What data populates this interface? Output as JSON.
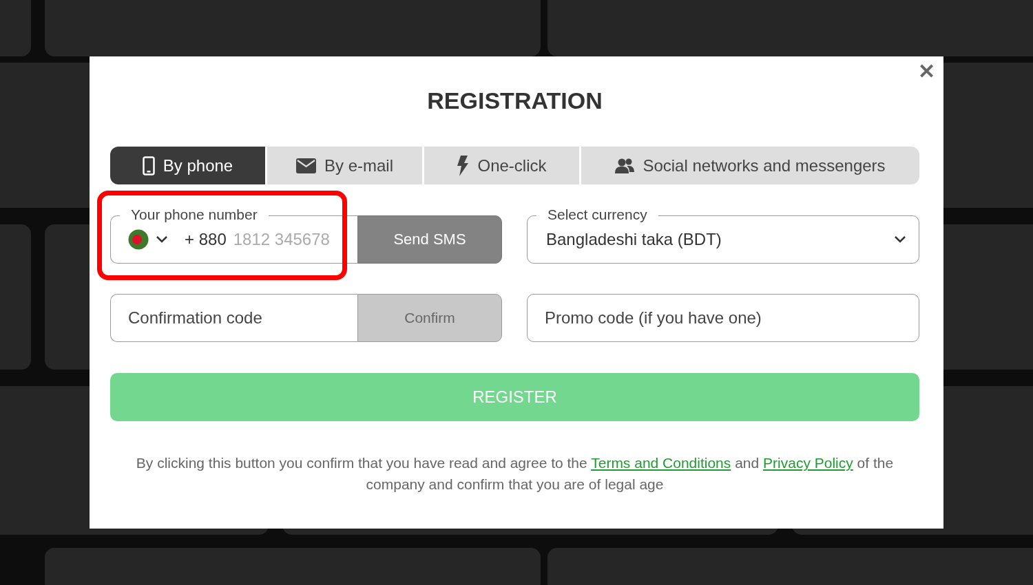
{
  "dialog": {
    "title": "REGISTRATION",
    "close": "✕"
  },
  "tabs": [
    {
      "label": "By phone",
      "kind": "phone",
      "selected": true
    },
    {
      "label": "By e-mail",
      "kind": "mail",
      "selected": false
    },
    {
      "label": "One-click",
      "kind": "bolt",
      "selected": false
    },
    {
      "label": "Social networks and messengers",
      "kind": "people",
      "selected": false
    }
  ],
  "phone": {
    "label": "Your phone number",
    "code": "+ 880",
    "placeholder": "1812 345678",
    "highlighted": true,
    "button": "Send SMS"
  },
  "currency": {
    "label": "Select currency",
    "value": "Bangladeshi taka (BDT)"
  },
  "confirmation": {
    "placeholder": "Confirmation code",
    "button": "Confirm"
  },
  "promo": {
    "placeholder": "Promo code (if you have one)"
  },
  "register_button": "REGISTER",
  "legal": {
    "before": "By clicking this button you confirm that you have read and agree to the",
    "terms_link": "Terms and Conditions",
    "middle": "and",
    "privacy_link": "Privacy Policy",
    "after": "of the company and confirm that you are of legal age"
  }
}
